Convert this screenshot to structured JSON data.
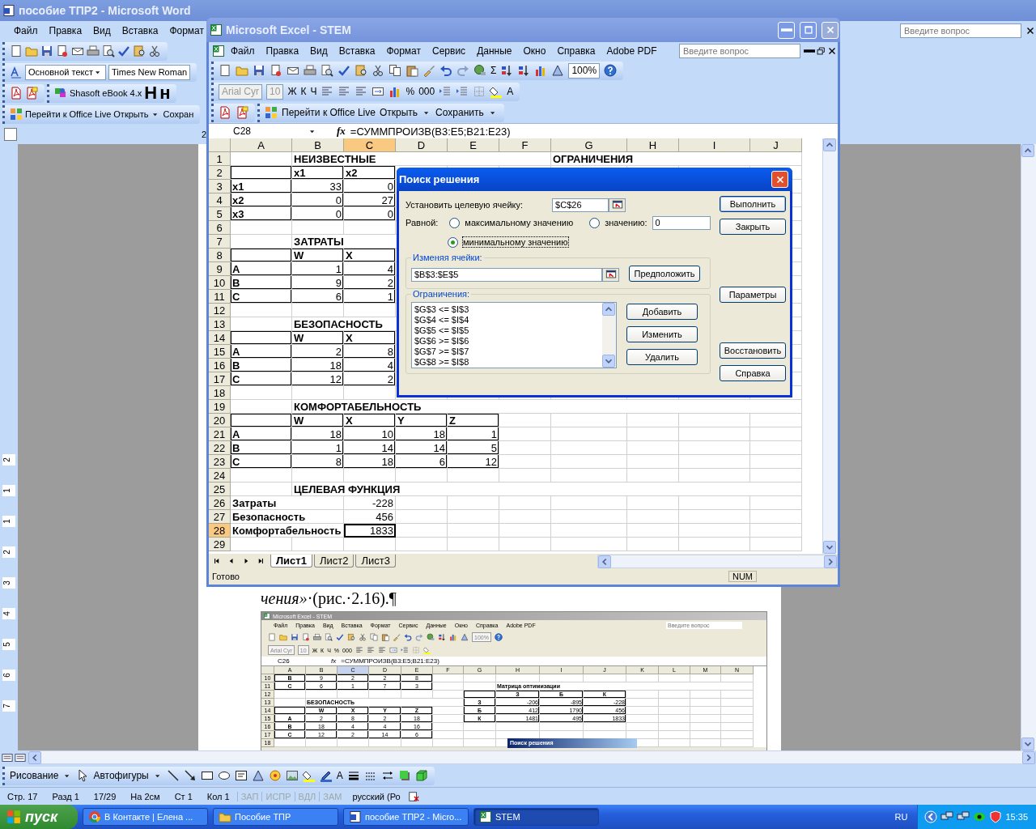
{
  "word": {
    "title": "пособие ТПР2 - Microsoft Word",
    "menu": [
      "Файл",
      "Правка",
      "Вид",
      "Вставка",
      "Формат"
    ],
    "help_box": {
      "placeholder": "Введите вопрос"
    },
    "style_box": "Основной текст",
    "font_box": "Times New Roman",
    "addin_label": "Shasoft eBook 4.x",
    "heading_buttons": [
      "H",
      "н"
    ],
    "office_live": [
      "Перейти к Office Live",
      "Открыть",
      "Сохран"
    ],
    "ruler_mark": "2",
    "vertical_ruler": [
      "2",
      "1",
      "1",
      "2",
      "3",
      "4",
      "5",
      "6",
      "7"
    ],
    "paragraph": "*чения»*·(рис.·2.16).¶",
    "figure": {
      "title": "Microsoft Excel - STEM",
      "menu": [
        "Файл",
        "Правка",
        "Вид",
        "Вставка",
        "Формат",
        "Сервис",
        "Данные",
        "Окно",
        "Справка",
        "Adobe PDF"
      ],
      "help_box": {
        "placeholder": "Введите вопрос"
      },
      "zoom": "100%",
      "font": "Arial Cyr",
      "size": "10",
      "format_buttons": [
        "Ж",
        "К",
        "Ч",
        "%",
        "000"
      ],
      "name_box": "C26",
      "fx": "fx",
      "formula": "=СУММПРОИЗВ(B3:E5;B21:E23)",
      "sheet": {
        "columns": [
          {
            "label": "A",
            "selected": false
          },
          {
            "label": "B",
            "selected": false
          },
          {
            "label": "C",
            "selected": true
          },
          {
            "label": "D",
            "selected": false
          },
          {
            "label": "E",
            "selected": false
          },
          {
            "label": "F",
            "selected": false
          },
          {
            "label": "G",
            "selected": false
          },
          {
            "label": "H",
            "selected": false
          },
          {
            "label": "I",
            "selected": false
          },
          {
            "label": "J",
            "selected": false
          },
          {
            "label": "K",
            "selected": false
          },
          {
            "label": "L",
            "selected": false
          },
          {
            "label": "M",
            "selected": false
          },
          {
            "label": "N",
            "selected": false
          }
        ],
        "rows": [
          {
            "n": "10",
            "selected": false,
            "cells": [
              {
                "text": "B",
                "kind": "head",
                "boxed": true
              },
              {
                "text": "9",
                "kind": "center",
                "boxed": true
              },
              {
                "text": "2",
                "kind": "center",
                "boxed": true
              },
              {
                "text": "2",
                "kind": "center",
                "boxed": true
              },
              {
                "text": "8",
                "kind": "center",
                "boxed": true
              }
            ]
          },
          {
            "n": "11",
            "selected": false,
            "cells": [
              {
                "text": "C",
                "kind": "head",
                "boxed": true
              },
              {
                "text": "6",
                "kind": "center",
                "boxed": true
              },
              {
                "text": "1",
                "kind": "center",
                "boxed": true
              },
              {
                "text": "7",
                "kind": "center",
                "boxed": true
              },
              {
                "text": "3",
                "kind": "center",
                "boxed": true
              },
              {},
              {},
              {
                "text": "Матрица оптимизации",
                "kind": "title"
              }
            ]
          },
          {
            "n": "12",
            "selected": false,
            "cells": [
              {},
              {},
              {},
              {},
              {},
              {},
              {
                "boxed": true
              },
              {
                "text": "З",
                "kind": "head",
                "boxed": true
              },
              {
                "text": "Б",
                "kind": "head",
                "boxed": true
              },
              {
                "text": "К",
                "kind": "head",
                "boxed": true
              }
            ]
          },
          {
            "n": "13",
            "selected": false,
            "cells": [
              {},
              {
                "text": "БЕЗОПАСНОСТЬ",
                "kind": "title"
              },
              {},
              {},
              {},
              {},
              {
                "text": "З",
                "kind": "head",
                "boxed": true
              },
              {
                "text": "-206",
                "kind": "number",
                "boxed": true
              },
              {
                "text": "-895",
                "kind": "number",
                "boxed": true
              },
              {
                "text": "-228",
                "kind": "number",
                "boxed": true
              }
            ]
          },
          {
            "n": "14",
            "selected": false,
            "cells": [
              {
                "boxed": true
              },
              {
                "text": "W",
                "kind": "head",
                "boxed": true
              },
              {
                "text": "X",
                "kind": "head",
                "boxed": true
              },
              {
                "text": "Y",
                "kind": "head",
                "boxed": true
              },
              {
                "text": "Z",
                "kind": "head",
                "boxed": true
              },
              {},
              {
                "text": "Б",
                "kind": "head",
                "boxed": true
              },
              {
                "text": "412",
                "kind": "number",
                "boxed": true
              },
              {
                "text": "1790",
                "kind": "number",
                "boxed": true
              },
              {
                "text": "456",
                "kind": "number",
                "boxed": true
              }
            ]
          },
          {
            "n": "15",
            "selected": false,
            "cells": [
              {
                "text": "A",
                "kind": "head",
                "boxed": true
              },
              {
                "text": "2",
                "kind": "center",
                "boxed": true
              },
              {
                "text": "8",
                "kind": "center",
                "boxed": true
              },
              {
                "text": "2",
                "kind": "center",
                "boxed": true
              },
              {
                "text": "18",
                "kind": "center",
                "boxed": true
              },
              {},
              {
                "text": "К",
                "kind": "head",
                "boxed": true
              },
              {
                "text": "1481",
                "kind": "number",
                "boxed": true
              },
              {
                "text": "495",
                "kind": "number",
                "boxed": true
              },
              {
                "text": "1833",
                "kind": "number",
                "boxed": true
              }
            ]
          },
          {
            "n": "16",
            "selected": false,
            "cells": [
              {
                "text": "B",
                "kind": "head",
                "boxed": true
              },
              {
                "text": "18",
                "kind": "center",
                "boxed": true
              },
              {
                "text": "4",
                "kind": "center",
                "boxed": true
              },
              {
                "text": "4",
                "kind": "center",
                "boxed": true
              },
              {
                "text": "16",
                "kind": "center",
                "boxed": true
              }
            ]
          },
          {
            "n": "17",
            "selected": false,
            "cells": [
              {
                "text": "C",
                "kind": "head",
                "boxed": true
              },
              {
                "text": "12",
                "kind": "center",
                "boxed": true
              },
              {
                "text": "2",
                "kind": "center",
                "boxed": true
              },
              {
                "text": "14",
                "kind": "center",
                "boxed": true
              },
              {
                "text": "6",
                "kind": "center",
                "boxed": true
              }
            ]
          },
          {
            "n": "18",
            "selected": false
          }
        ]
      },
      "dialog_title": "Поиск решения"
    },
    "drawing_toolbar": [
      "Рисование",
      "Автофигуры"
    ],
    "font_color": "A",
    "status": [
      "Стр. 17",
      "Разд 1",
      "17/29",
      "На 2см",
      "Ст 1",
      "Кол 1"
    ],
    "status_modes": [
      {
        "label": "ЗАП",
        "on": false
      },
      {
        "label": "ИСПР",
        "on": false
      },
      {
        "label": "ВДЛ",
        "on": false
      },
      {
        "label": "ЗАМ",
        "on": false
      }
    ],
    "language": "русский (Ро"
  },
  "excel": {
    "title": "Microsoft Excel - STEM",
    "menu": [
      "Файл",
      "Правка",
      "Вид",
      "Вставка",
      "Формат",
      "Сервис",
      "Данные",
      "Окно",
      "Справка",
      "Adobe PDF"
    ],
    "help_box": {
      "placeholder": "Введите вопрос"
    },
    "sum_symbol": "Σ",
    "zoom": "100%",
    "font": "Arial Cyr",
    "size": "10",
    "format_buttons": [
      "Ж",
      "К",
      "Ч",
      "%",
      "000"
    ],
    "font_color": "A",
    "office_live": [
      "Перейти к Office Live",
      "Открыть",
      "Сохранить"
    ],
    "name_box": "C28",
    "fx": "fx",
    "formula": "=СУММПРОИЗВ(B3:E5;B21:E23)",
    "sheet": {
      "columns": [
        {
          "label": "A",
          "selected": false
        },
        {
          "label": "B",
          "selected": false
        },
        {
          "label": "C",
          "selected": true
        },
        {
          "label": "D",
          "selected": false
        },
        {
          "label": "E",
          "selected": false
        },
        {
          "label": "F",
          "selected": false
        },
        {
          "label": "G",
          "selected": false
        },
        {
          "label": "H",
          "selected": false
        },
        {
          "label": "I",
          "selected": false
        },
        {
          "label": "J",
          "selected": false
        }
      ],
      "rows": [
        {
          "n": "1",
          "selected": false,
          "cells": [
            {},
            {
              "text": "НЕИЗВЕСТНЫЕ",
              "kind": "title"
            },
            {},
            {},
            {},
            {},
            {
              "text": "ОГРАНИЧЕНИЯ",
              "kind": "title"
            }
          ]
        },
        {
          "n": "2",
          "selected": false,
          "cells": [
            {
              "boxed": true
            },
            {
              "text": "x1",
              "kind": "label",
              "boxed": true
            },
            {
              "text": "x2",
              "kind": "label",
              "boxed": true
            }
          ]
        },
        {
          "n": "3",
          "selected": false,
          "cells": [
            {
              "text": "x1",
              "kind": "label",
              "boxed": true
            },
            {
              "text": "33",
              "kind": "number",
              "boxed": true
            },
            {
              "text": "0",
              "kind": "number",
              "boxed": true
            }
          ]
        },
        {
          "n": "4",
          "selected": false,
          "cells": [
            {
              "text": "x2",
              "kind": "label",
              "boxed": true
            },
            {
              "text": "0",
              "kind": "number",
              "boxed": true
            },
            {
              "text": "27",
              "kind": "number",
              "boxed": true
            }
          ]
        },
        {
          "n": "5",
          "selected": false,
          "cells": [
            {
              "text": "x3",
              "kind": "label",
              "boxed": true
            },
            {
              "text": "0",
              "kind": "number",
              "boxed": true
            },
            {
              "text": "0",
              "kind": "number",
              "boxed": true
            }
          ]
        },
        {
          "n": "6",
          "selected": false
        },
        {
          "n": "7",
          "selected": false,
          "cells": [
            {},
            {
              "text": "ЗАТРАТЫ",
              "kind": "title"
            }
          ]
        },
        {
          "n": "8",
          "selected": false,
          "cells": [
            {
              "boxed": true
            },
            {
              "text": "W",
              "kind": "label",
              "boxed": true
            },
            {
              "text": "X",
              "kind": "label",
              "boxed": true
            }
          ]
        },
        {
          "n": "9",
          "selected": false,
          "cells": [
            {
              "text": "A",
              "kind": "label",
              "boxed": true
            },
            {
              "text": "1",
              "kind": "number",
              "boxed": true
            },
            {
              "text": "4",
              "kind": "number",
              "boxed": true
            }
          ]
        },
        {
          "n": "10",
          "selected": false,
          "cells": [
            {
              "text": "B",
              "kind": "label",
              "boxed": true
            },
            {
              "text": "9",
              "kind": "number",
              "boxed": true
            },
            {
              "text": "2",
              "kind": "number",
              "boxed": true
            }
          ]
        },
        {
          "n": "11",
          "selected": false,
          "cells": [
            {
              "text": "C",
              "kind": "label",
              "boxed": true
            },
            {
              "text": "6",
              "kind": "number",
              "boxed": true
            },
            {
              "text": "1",
              "kind": "number",
              "boxed": true
            }
          ]
        },
        {
          "n": "12",
          "selected": false
        },
        {
          "n": "13",
          "selected": false,
          "cells": [
            {},
            {
              "text": "БЕЗОПАСНОСТЬ",
              "kind": "title"
            }
          ]
        },
        {
          "n": "14",
          "selected": false,
          "cells": [
            {
              "boxed": true
            },
            {
              "text": "W",
              "kind": "label",
              "boxed": true
            },
            {
              "text": "X",
              "kind": "label",
              "boxed": true
            }
          ]
        },
        {
          "n": "15",
          "selected": false,
          "cells": [
            {
              "text": "A",
              "kind": "label",
              "boxed": true
            },
            {
              "text": "2",
              "kind": "number",
              "boxed": true
            },
            {
              "text": "8",
              "kind": "number",
              "boxed": true
            }
          ]
        },
        {
          "n": "16",
          "selected": false,
          "cells": [
            {
              "text": "B",
              "kind": "label",
              "boxed": true
            },
            {
              "text": "18",
              "kind": "number",
              "boxed": true
            },
            {
              "text": "4",
              "kind": "number",
              "boxed": true
            }
          ]
        },
        {
          "n": "17",
          "selected": false,
          "cells": [
            {
              "text": "C",
              "kind": "label",
              "boxed": true
            },
            {
              "text": "12",
              "kind": "number",
              "boxed": true
            },
            {
              "text": "2",
              "kind": "number",
              "boxed": true
            }
          ]
        },
        {
          "n": "18",
          "selected": false
        },
        {
          "n": "19",
          "selected": false,
          "cells": [
            {},
            {
              "text": "КОМФОРТАБЕЛЬНОСТЬ",
              "kind": "title"
            }
          ]
        },
        {
          "n": "20",
          "selected": false,
          "cells": [
            {
              "boxed": true
            },
            {
              "text": "W",
              "kind": "label",
              "boxed": true
            },
            {
              "text": "X",
              "kind": "label",
              "boxed": true
            },
            {
              "text": "Y",
              "kind": "label",
              "boxed": true
            },
            {
              "text": "Z",
              "kind": "label",
              "boxed": true
            }
          ]
        },
        {
          "n": "21",
          "selected": false,
          "cells": [
            {
              "text": "A",
              "kind": "label",
              "boxed": true
            },
            {
              "text": "18",
              "kind": "number",
              "boxed": true
            },
            {
              "text": "10",
              "kind": "number",
              "boxed": true
            },
            {
              "text": "18",
              "kind": "number",
              "boxed": true
            },
            {
              "text": "1",
              "kind": "number",
              "boxed": true
            }
          ]
        },
        {
          "n": "22",
          "selected": false,
          "cells": [
            {
              "text": "B",
              "kind": "label",
              "boxed": true
            },
            {
              "text": "1",
              "kind": "number",
              "boxed": true
            },
            {
              "text": "14",
              "kind": "number",
              "boxed": true
            },
            {
              "text": "14",
              "kind": "number",
              "boxed": true
            },
            {
              "text": "5",
              "kind": "number",
              "boxed": true
            }
          ]
        },
        {
          "n": "23",
          "selected": false,
          "cells": [
            {
              "text": "C",
              "kind": "label",
              "boxed": true
            },
            {
              "text": "8",
              "kind": "number",
              "boxed": true
            },
            {
              "text": "18",
              "kind": "number",
              "boxed": true
            },
            {
              "text": "6",
              "kind": "number",
              "boxed": true
            },
            {
              "text": "12",
              "kind": "number",
              "boxed": true
            }
          ]
        },
        {
          "n": "24",
          "selected": false
        },
        {
          "n": "25",
          "selected": false,
          "cells": [
            {},
            {
              "text": "ЦЕЛЕВАЯ ФУНКЦИЯ",
              "kind": "title"
            }
          ]
        },
        {
          "n": "26",
          "selected": false,
          "cells": [
            {
              "text": "Затраты",
              "kind": "label"
            },
            {},
            {
              "text": "-228",
              "kind": "number"
            }
          ]
        },
        {
          "n": "27",
          "selected": false,
          "cells": [
            {
              "text": "Безопасность",
              "kind": "label"
            },
            {},
            {
              "text": "456",
              "kind": "number"
            }
          ]
        },
        {
          "n": "28",
          "selected": true,
          "cells": [
            {
              "text": "Комфортабельность",
              "kind": "label"
            },
            {},
            {
              "text": "1833",
              "kind": "number"
            }
          ]
        },
        {
          "n": "29",
          "selected": false
        }
      ]
    },
    "sheets": [
      {
        "label": "Лист1",
        "selected": true
      },
      {
        "label": "Лист2",
        "selected": false
      },
      {
        "label": "Лист3",
        "selected": false
      }
    ],
    "status": "Готово",
    "num": "NUM"
  },
  "dialog": {
    "title": "Поиск решения",
    "target_label": "Установить целевую ячейку:",
    "target": "$C$26",
    "equal_label": "Равной:",
    "options": [
      {
        "label": "максимальному значению",
        "selected": false
      },
      {
        "label": "значению:",
        "selected": false
      },
      {
        "label": "минимальному значению",
        "selected": true
      }
    ],
    "value": "0",
    "changing_label": "Изменяя ячейки:",
    "changing": "$B$3:$E$5",
    "guess": "Предположить",
    "constraints_label": "Ограничения:",
    "constraints": [
      "$G$3 <= $I$3",
      "$G$4 <= $I$4",
      "$G$5 <= $I$5",
      "$G$6 >= $I$6",
      "$G$7 >= $I$7",
      "$G$8 >= $I$8"
    ],
    "list_buttons": [
      "Добавить",
      "Изменить",
      "Удалить"
    ],
    "side_buttons": [
      "Выполнить",
      "Закрыть",
      "Параметры",
      "Восстановить",
      "Справка"
    ]
  },
  "taskbar": {
    "start": "пуск",
    "tasks": [
      {
        "label": "В Контакте | Елена ...",
        "selected": false
      },
      {
        "label": "Пособие ТПР",
        "selected": false
      },
      {
        "label": "пособие ТПР2 - Micro...",
        "selected": false
      },
      {
        "label": "STEM",
        "selected": true
      }
    ],
    "language": "RU",
    "clock": "15:35"
  }
}
